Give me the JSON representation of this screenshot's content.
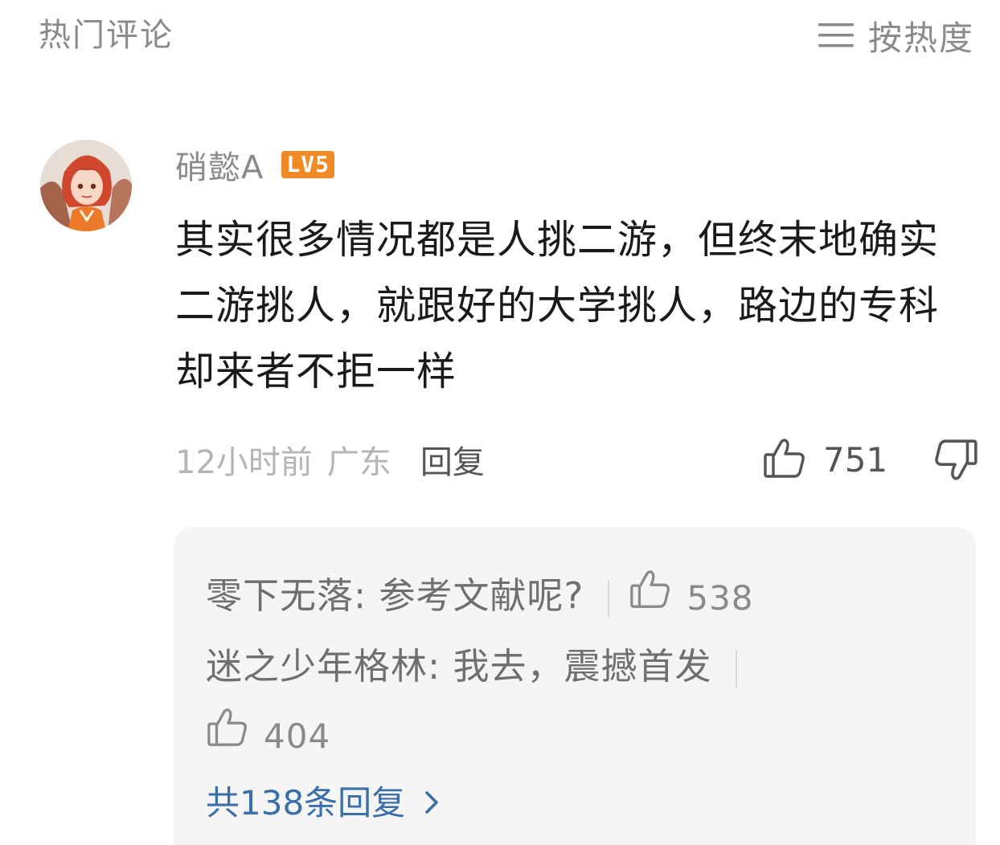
{
  "header": {
    "title": "热门评论",
    "sort_label": "按热度"
  },
  "comment": {
    "username": "硝懿A",
    "level": "LV5",
    "text": "其实很多情况都是人挑二游，但终末地确实二游挑人，就跟好的大学挑人，路边的专科却来者不拒一样",
    "time": "12小时前",
    "location": "广东",
    "reply_label": "回复",
    "likes": "751"
  },
  "replies": {
    "items": [
      {
        "text": "零下无落: 参考文献呢?",
        "likes": "538"
      },
      {
        "text": "迷之少年格林: 我去，震撼首发",
        "likes": "404"
      }
    ],
    "more_label": "共138条回复"
  },
  "colors": {
    "badge": "#f08a24",
    "link": "#3b6fa8",
    "muted": "#8a8a8a",
    "reply_bg": "#f5f5f6"
  },
  "icons": {
    "sort": "menu-lines-icon",
    "like": "thumbs-up-icon",
    "dislike": "thumbs-down-icon",
    "more": "chevron-right-icon"
  }
}
